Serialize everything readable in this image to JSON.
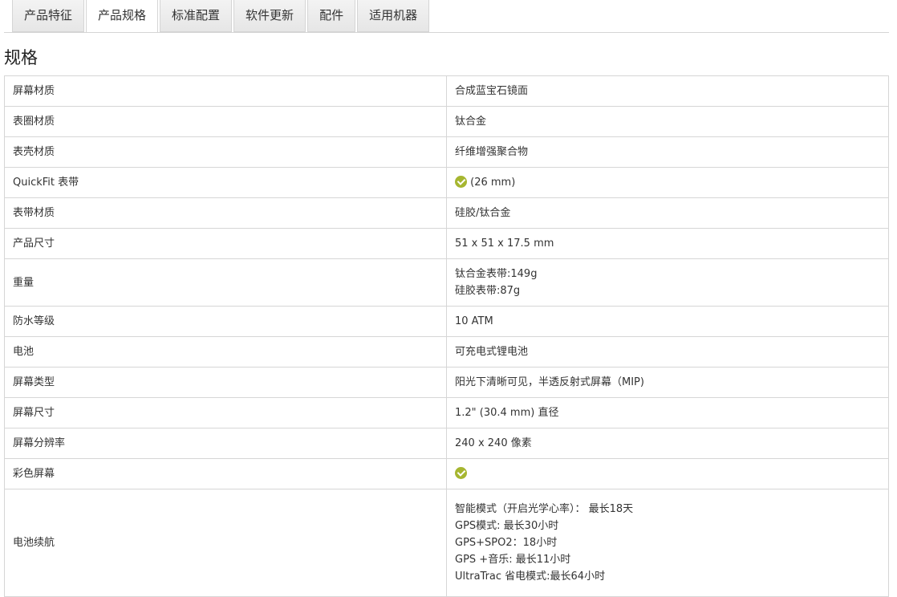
{
  "tabs": [
    "产品特征",
    "产品规格",
    "标准配置",
    "软件更新",
    "配件",
    "适用机器"
  ],
  "active_tab": "产品规格",
  "heading": "规格",
  "specs": [
    {
      "label": "屏幕材质",
      "value": "合成蓝宝石镜面"
    },
    {
      "label": "表圈材质",
      "value": "钛合金"
    },
    {
      "label": "表壳材质",
      "value": "纤维增强聚合物"
    },
    {
      "label": "QuickFit 表带",
      "value": "(26 mm)",
      "check": true
    },
    {
      "label": "表带材质",
      "value": "硅胶/钛合金"
    },
    {
      "label": "产品尺寸",
      "value": "51 x 51 x 17.5 mm"
    },
    {
      "label": "重量",
      "lines": [
        "钛合金表带:149g",
        "硅胶表带:87g"
      ]
    },
    {
      "label": "防水等级",
      "value": "10 ATM"
    },
    {
      "label": "电池",
      "value": "可充电式锂电池"
    },
    {
      "label": "屏幕类型",
      "value": "阳光下清晰可见，半透反射式屏幕（MIP)"
    },
    {
      "label": "屏幕尺寸",
      "value": "1.2\" (30.4 mm) 直径"
    },
    {
      "label": "屏幕分辨率",
      "value": "240 x 240 像素"
    },
    {
      "label": "彩色屏幕",
      "value": "",
      "check": true
    },
    {
      "label": "电池续航",
      "lines": [
        "智能模式（开启光学心率）： 最长18天",
        "GPS模式: 最长30小时",
        "GPS+SPO2：18小时",
        "GPS +音乐: 最长11小时",
        "UltraTrac 省电模式:最长64小时"
      ]
    }
  ],
  "colors": {
    "check": "#a6b630",
    "border": "#d6d6d6"
  }
}
